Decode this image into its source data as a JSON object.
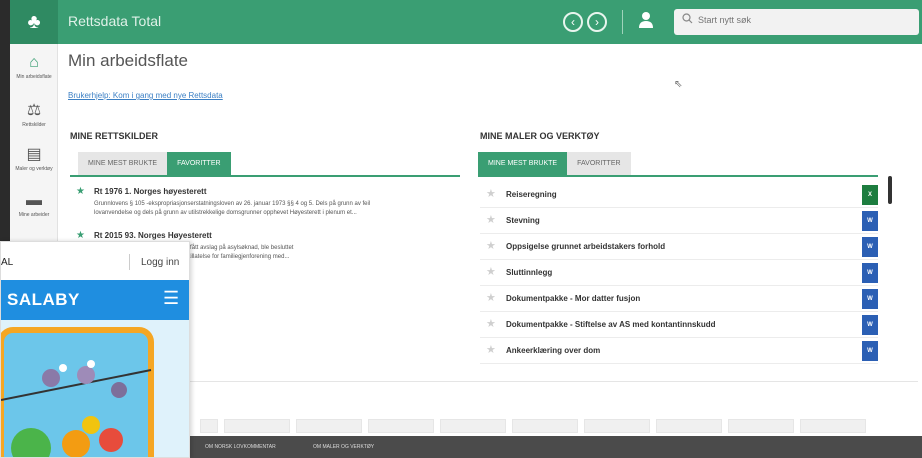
{
  "topbar": {
    "app_title": "Rettsdata Total",
    "search_placeholder": "Start nytt søk",
    "icons": [
      "tree-icon",
      "back-icon",
      "forward-icon",
      "user-icon",
      "search-icon"
    ]
  },
  "leftnav": {
    "items": [
      {
        "label": "Min arbeidsflate",
        "icon": "home-icon"
      },
      {
        "label": "Rettskilder",
        "icon": "scales-icon"
      },
      {
        "label": "Maler og verktøy",
        "icon": "document-icon"
      },
      {
        "label": "Mine arbeider",
        "icon": "folder-icon"
      }
    ]
  },
  "main": {
    "title": "Min arbeidsflate",
    "help_link": "Brukerhjelp: Kom i gang med nye Rettsdata"
  },
  "rettskilder": {
    "heading": "MINE RETTSKILDER",
    "tabs": [
      {
        "label": "MINE MEST BRUKTE",
        "active": false
      },
      {
        "label": "FAVORITTER",
        "active": true
      }
    ],
    "items": [
      {
        "title": "Rt 1976 1. Norges høyesterett",
        "desc1": "Grunnlovens § 105 -ekspropriasjonserstatningsloven av 26. januar 1973 §§ 4 og 5. Dels på grunn av feil",
        "desc2": "lovanvendelse og dels på grunn av utilstrekkelige domsgrunner opphevet Høyesterett i plenum et..."
      },
      {
        "title": "Rt 2015 93. Norges Høyesterett",
        "desc1": "oholdt seg ulovlig i Norge etter å ha fått avslag på asylsøknad, ble besluttet",
        "desc2": "hun avslag på søknad om oppholdstillatelse for familiegjenforening med..."
      }
    ]
  },
  "maler": {
    "heading": "MINE MALER OG VERKTØY",
    "tabs": [
      {
        "label": "MINE MEST BRUKTE",
        "active": true
      },
      {
        "label": "FAVORITTER",
        "active": false
      }
    ],
    "items": [
      {
        "label": "Reiseregning",
        "type": "excel",
        "badge": "X"
      },
      {
        "label": "Stevning",
        "type": "word",
        "badge": "W"
      },
      {
        "label": "Oppsigelse grunnet arbeidstakers forhold",
        "type": "word",
        "badge": "W"
      },
      {
        "label": "Sluttinnlegg",
        "type": "word",
        "badge": "W"
      },
      {
        "label": "Dokumentpakke - Mor datter fusjon",
        "type": "word",
        "badge": "W"
      },
      {
        "label": "Dokumentpakke - Stiftelse av AS med kontantinnskudd",
        "type": "word",
        "badge": "W"
      },
      {
        "label": "Ankeerklæring over dom",
        "type": "word",
        "badge": "W"
      }
    ]
  },
  "footer": {
    "links": [
      "OM NORSK LOVKOMMENTAR",
      "OM MALER OG VERKTØY"
    ]
  },
  "overlay": {
    "brand_tail": "AL",
    "login": "Logg inn",
    "site_name": "SALABY",
    "menu_icon": "hamburger-icon"
  },
  "colors": {
    "brand_green": "#3a9e73",
    "overlay_blue": "#1f8ee0",
    "word_blue": "#2b5fb4",
    "excel_green": "#1d7d3f"
  }
}
